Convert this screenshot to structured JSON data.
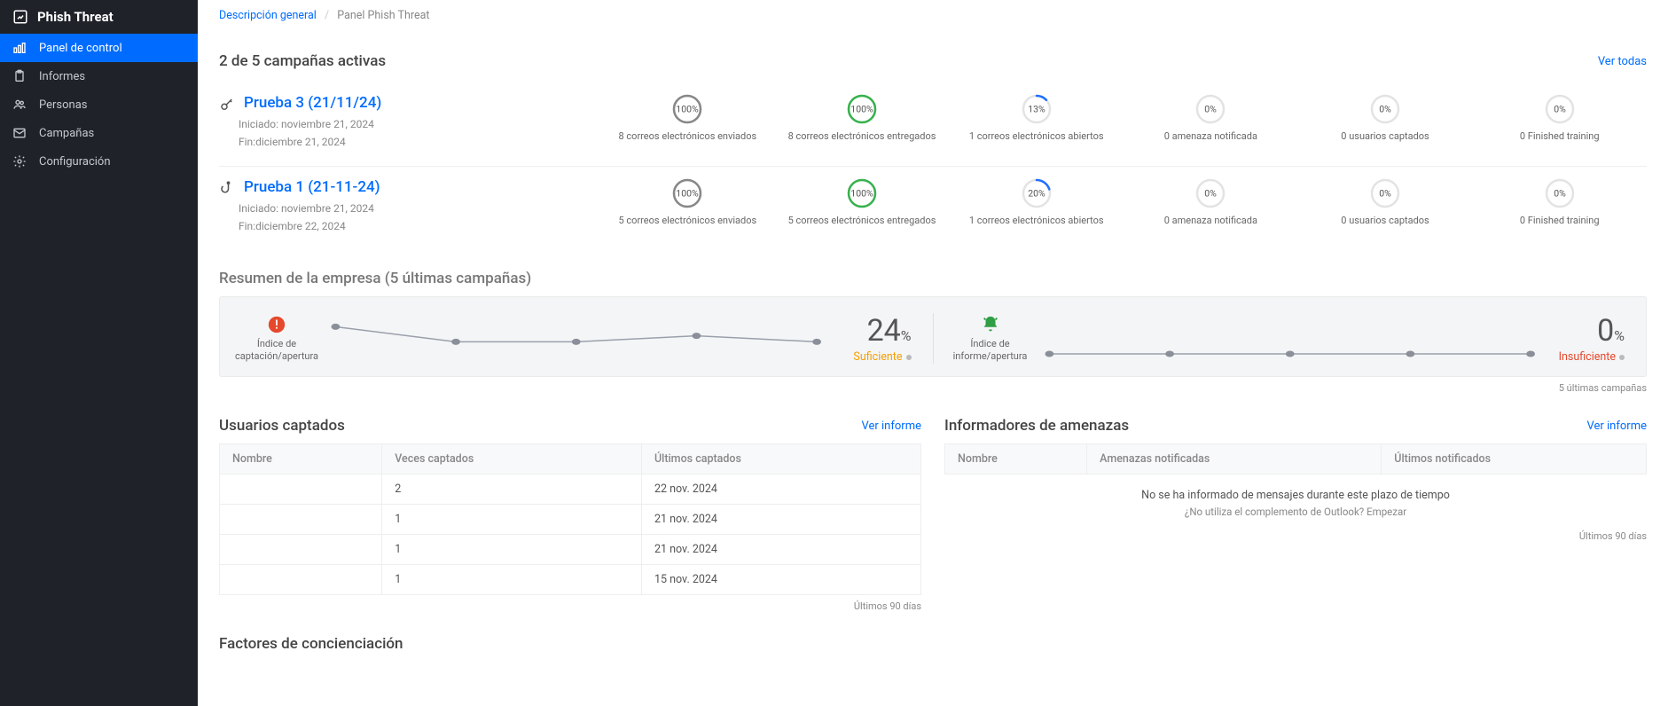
{
  "sidebar": {
    "app_name": "Phish Threat",
    "items": [
      {
        "label": "Panel de control",
        "icon": "chart-bar-icon",
        "active": true
      },
      {
        "label": "Informes",
        "icon": "clipboard-icon"
      },
      {
        "label": "Personas",
        "icon": "users-icon"
      },
      {
        "label": "Campañas",
        "icon": "mail-icon"
      },
      {
        "label": "Configuración",
        "icon": "gear-icon"
      }
    ]
  },
  "breadcrumb": {
    "root": "Descripción general",
    "current": "Panel Phish Threat"
  },
  "campaigns": {
    "heading": "2 de 5 campañas activas",
    "view_all": "Ver todas",
    "items": [
      {
        "icon": "key-icon",
        "title": "Prueba 3 (21/11/24)",
        "started": "Iniciado: noviembre 21, 2024",
        "ends": "Fin:diciembre 21, 2024",
        "metrics": [
          {
            "pct": 100,
            "color": "#888888",
            "label": "8 correos electrónicos enviados"
          },
          {
            "pct": 100,
            "color": "#37b24d",
            "label": "8 correos electrónicos entregados"
          },
          {
            "pct": 13,
            "color": "#1f6fff",
            "label": "1 correos electrónicos abiertos"
          },
          {
            "pct": 0,
            "color": "#888888",
            "label": "0 amenaza notificada"
          },
          {
            "pct": 0,
            "color": "#888888",
            "label": "0 usuarios captados"
          },
          {
            "pct": 0,
            "color": "#888888",
            "label": "0 Finished training"
          }
        ]
      },
      {
        "icon": "hook-icon",
        "title": "Prueba 1 (21-11-24)",
        "started": "Iniciado: noviembre 21, 2024",
        "ends": "Fin:diciembre 22, 2024",
        "metrics": [
          {
            "pct": 100,
            "color": "#888888",
            "label": "5 correos electrónicos enviados"
          },
          {
            "pct": 100,
            "color": "#37b24d",
            "label": "5 correos electrónicos entregados"
          },
          {
            "pct": 20,
            "color": "#1f6fff",
            "label": "1 correos electrónicos abiertos"
          },
          {
            "pct": 0,
            "color": "#888888",
            "label": "0 amenaza notificada"
          },
          {
            "pct": 0,
            "color": "#888888",
            "label": "0 usuarios captados"
          },
          {
            "pct": 0,
            "color": "#888888",
            "label": "0 Finished training"
          }
        ]
      }
    ]
  },
  "summary": {
    "title": "Resumen de la empresa (5 últimas campañas)",
    "left": {
      "icon_label": "Índice de captación/apertura",
      "value": "24",
      "unit": "%",
      "status": "Suficiente",
      "status_color": "#f59f00"
    },
    "right": {
      "icon_label": "Índice de informe/apertura",
      "value": "0",
      "unit": "%",
      "status": "Insuficiente",
      "status_color": "#e6482c"
    },
    "footnote": "5 últimas campañas"
  },
  "captured": {
    "title": "Usuarios captados",
    "view_link": "Ver informe",
    "cols": [
      "Nombre",
      "Veces captados",
      "Últimos captados"
    ],
    "rows": [
      {
        "name": "",
        "count": "2",
        "last": "22 nov. 2024"
      },
      {
        "name": "",
        "count": "1",
        "last": "21 nov. 2024"
      },
      {
        "name": "",
        "count": "1",
        "last": "21 nov. 2024"
      },
      {
        "name": "",
        "count": "1",
        "last": "15 nov. 2024"
      }
    ],
    "footnote": "Últimos 90 días"
  },
  "reporters": {
    "title": "Informadores de amenazas",
    "view_link": "Ver informe",
    "cols": [
      "Nombre",
      "Amenazas notificadas",
      "Últimos notificados"
    ],
    "empty": "No se ha informado de mensajes durante este plazo de tiempo",
    "empty_sub": "¿No utiliza el complemento de Outlook? Empezar",
    "footnote": "Últimos 90 días"
  },
  "awareness": {
    "title": "Factores de concienciación"
  },
  "chart_data": [
    {
      "type": "line",
      "title": "Índice de captación/apertura — 5 últimas campañas",
      "x": [
        1,
        2,
        3,
        4,
        5
      ],
      "values": [
        45,
        20,
        20,
        30,
        20
      ],
      "ylim": [
        0,
        50
      ]
    },
    {
      "type": "line",
      "title": "Índice de informe/apertura — 5 últimas campañas",
      "x": [
        1,
        2,
        3,
        4,
        5
      ],
      "values": [
        0,
        0,
        0,
        0,
        0
      ],
      "ylim": [
        0,
        50
      ]
    }
  ]
}
